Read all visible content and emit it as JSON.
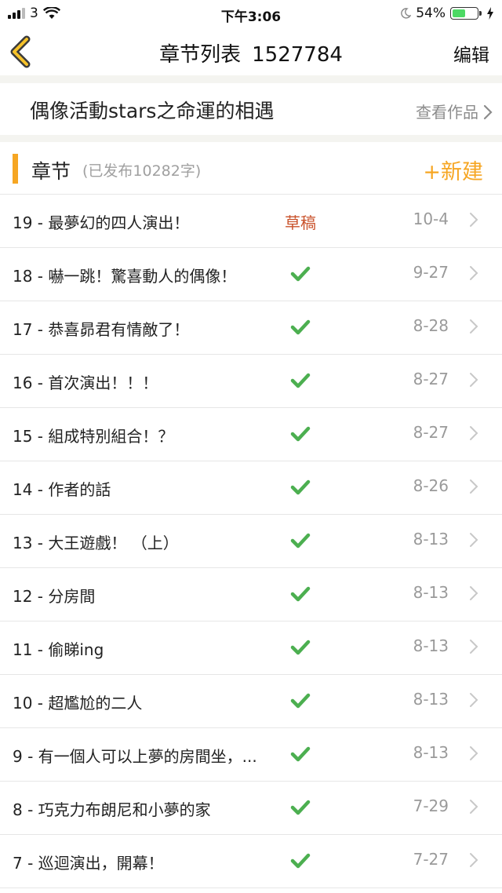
{
  "status_bar": {
    "carrier": "3",
    "time": "下午3:06",
    "battery_percent": "54%",
    "battery_level": 0.54,
    "icons": [
      "signal-icon",
      "wifi-icon",
      "moon-icon",
      "battery-icon",
      "charging-icon"
    ]
  },
  "nav": {
    "title": "章节列表",
    "work_id": "1527784",
    "edit_label": "编辑",
    "back_icon": "chevron-left-icon"
  },
  "work": {
    "title": "偶像活動stars之命運的相遇",
    "view_label": "查看作品"
  },
  "section": {
    "title": "章节",
    "subtitle": "(已发布10282字)",
    "new_label": "+新建"
  },
  "colors": {
    "accent": "#f6a623",
    "draft": "#c9522b",
    "published_check": "#4caf50"
  },
  "chapters": [
    {
      "title": "19 - 最夢幻的四人演出！",
      "status": "草稿",
      "published": false,
      "date": "10-4"
    },
    {
      "title": "18 - 嚇一跳！驚喜動人的偶像！",
      "status": "",
      "published": true,
      "date": "9-27"
    },
    {
      "title": "17 - 恭喜昴君有情敵了！",
      "status": "",
      "published": true,
      "date": "8-28"
    },
    {
      "title": "16 - 首次演出！！！",
      "status": "",
      "published": true,
      "date": "8-27"
    },
    {
      "title": "15 - 組成特別組合！？",
      "status": "",
      "published": true,
      "date": "8-27"
    },
    {
      "title": "14 - 作者的話",
      "status": "",
      "published": true,
      "date": "8-26"
    },
    {
      "title": "13 - 大王遊戲！ （上）",
      "status": "",
      "published": true,
      "date": "8-13"
    },
    {
      "title": "12 - 分房間",
      "status": "",
      "published": true,
      "date": "8-13"
    },
    {
      "title": "11 - 偷睇ing",
      "status": "",
      "published": true,
      "date": "8-13"
    },
    {
      "title": "10 - 超尷尬的二人",
      "status": "",
      "published": true,
      "date": "8-13"
    },
    {
      "title": "9 - 有一個人可以上夢的房間坐，...",
      "status": "",
      "published": true,
      "date": "8-13"
    },
    {
      "title": "8 - 巧克力布朗尼和小夢的家",
      "status": "",
      "published": true,
      "date": "7-29"
    },
    {
      "title": "7 - 巡迴演出，開幕！",
      "status": "",
      "published": true,
      "date": "7-27"
    }
  ]
}
